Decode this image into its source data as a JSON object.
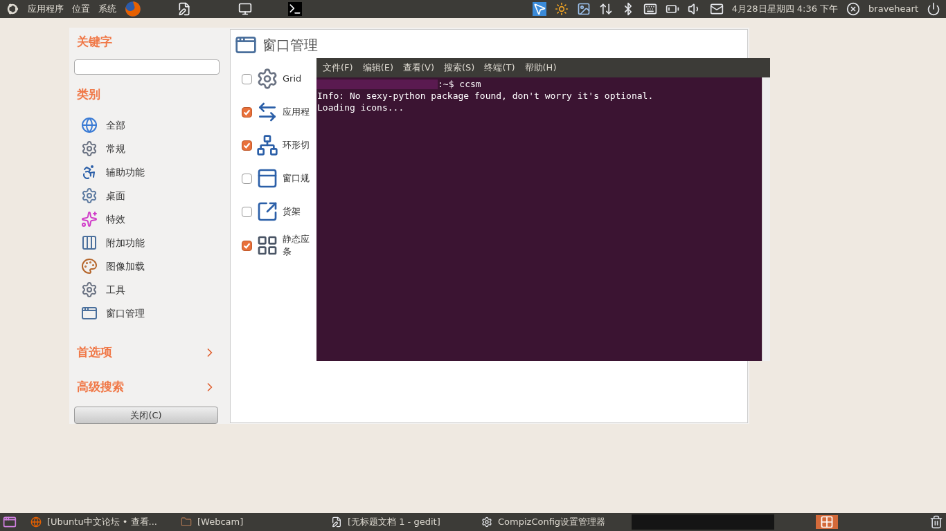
{
  "top_panel": {
    "menus": [
      "应用程序",
      "位置",
      "系统"
    ],
    "clock": "4月28日星期四 4:36 下午",
    "user": "braveheart"
  },
  "ccsm": {
    "keyword_heading": "关键字",
    "category_heading": "类别",
    "categories": [
      "全部",
      "常规",
      "辅助功能",
      "桌面",
      "特效",
      "附加功能",
      "图像加载",
      "工具",
      "窗口管理"
    ],
    "sections": [
      "首选项",
      "高级搜索"
    ],
    "close_button": "关闭(C)",
    "page_title": "窗口管理",
    "plugins": [
      {
        "lines": [
          "Grid"
        ],
        "checked": false
      },
      {
        "lines": [
          "应用程"
        ],
        "checked": true
      },
      {
        "lines": [
          "环形切"
        ],
        "checked": true
      },
      {
        "lines": [
          "窗口规"
        ],
        "checked": false
      },
      {
        "lines": [
          "货架"
        ],
        "checked": false
      },
      {
        "lines": [
          "静态应",
          "条"
        ],
        "checked": true
      }
    ]
  },
  "terminal": {
    "menus": [
      "文件(F)",
      "编辑(E)",
      "查看(V)",
      "搜索(S)",
      "终端(T)",
      "帮助(H)"
    ],
    "prompt": ":~$ ccsm",
    "lines": [
      "Info: No sexy-python package found, don't worry it's optional.",
      "Loading icons..."
    ]
  },
  "taskbar": {
    "tasks": [
      "[Ubuntu中文论坛 • 查看...",
      "[Webcam]",
      "[无标题文档 1 - gedit]",
      "CompizConfig设置管理器"
    ]
  }
}
